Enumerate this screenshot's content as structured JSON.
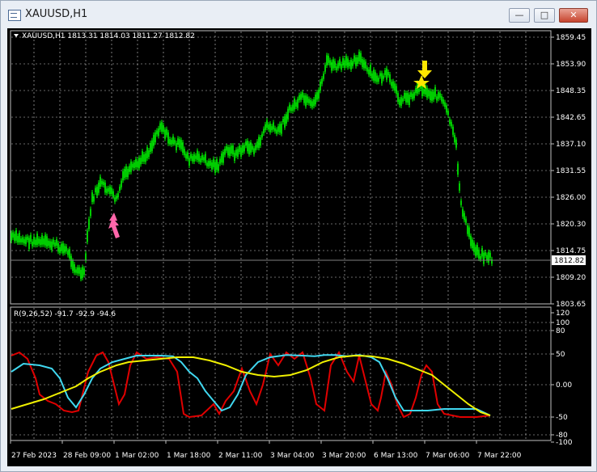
{
  "window": {
    "title": "XAUUSD,H1",
    "minimize_label": "—",
    "maximize_label": "□",
    "close_label": "✕"
  },
  "main_chart": {
    "header": "XAUUSD,H1  1813.31 1814.03 1811.27 1812.82",
    "current_price_label": "1812.82",
    "price_ticks": [
      "1859.45",
      "1853.90",
      "1848.35",
      "1842.65",
      "1837.10",
      "1831.55",
      "1826.00",
      "1820.30",
      "1814.75",
      "1809.20",
      "1803.65"
    ],
    "candle_color": "#00ff00",
    "signals": [
      {
        "type": "buy-arrow",
        "color": "#ff66aa"
      },
      {
        "type": "sell-arrow",
        "color": "#ffe800"
      }
    ]
  },
  "indicator": {
    "header": "R(9,26,52) -91.7 -92.9 -94.6",
    "level_ticks": [
      "120",
      "100",
      "80",
      "50",
      "0.00",
      "-50",
      "-80",
      "-100"
    ],
    "line_colors": {
      "fast": "#e00000",
      "mid": "#40d8f0",
      "slow": "#f0f000"
    }
  },
  "time_axis": {
    "labels": [
      "27 Feb 2023",
      "28 Feb 09:00",
      "1 Mar 02:00",
      "1 Mar 18:00",
      "2 Mar 11:00",
      "3 Mar 04:00",
      "3 Mar 20:00",
      "6 Mar 13:00",
      "7 Mar 06:00",
      "7 Mar 22:00"
    ]
  }
}
